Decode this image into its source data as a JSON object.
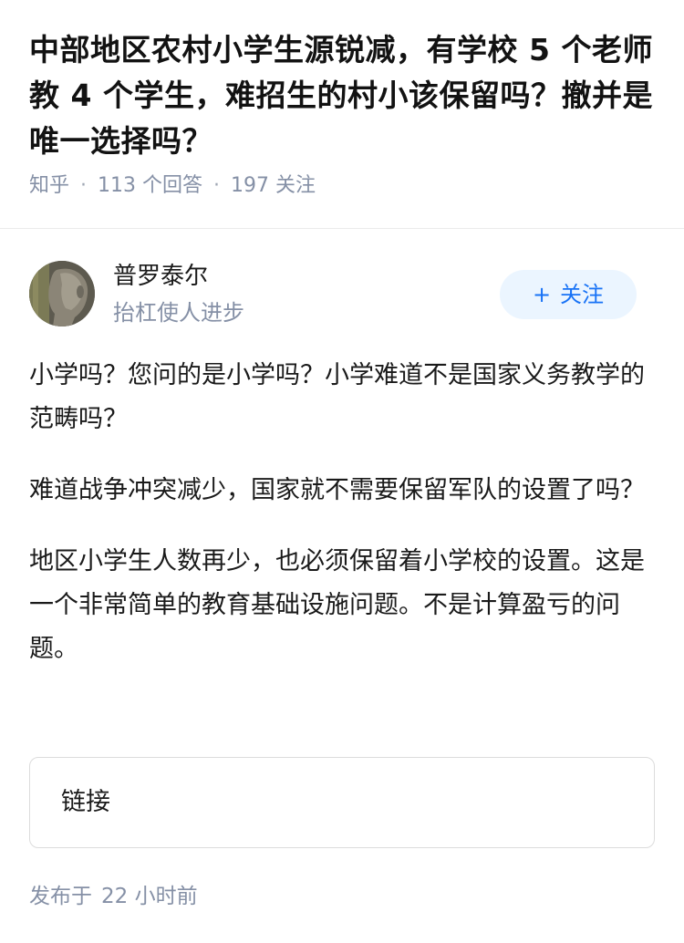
{
  "question": {
    "title": "中部地区农村小学生源锐减，有学校 5 个老师教 4 个学生，难招生的村小该保留吗？撤并是唯一选择吗？",
    "source": "知乎",
    "answers_count": "113 个回答",
    "followers_count": "197 关注"
  },
  "author": {
    "name": "普罗泰尔",
    "bio": "抬杠使人进步",
    "avatar_icon": "avatar-photo",
    "follow_label": "关注",
    "follow_plus": "+"
  },
  "answer": {
    "paragraphs": [
      "小学吗？您问的是小学吗？小学难道不是国家义务教学的范畴吗？",
      "难道战争冲突减少，国家就不需要保留军队的设置了吗？",
      "地区小学生人数再少，也必须保留着小学校的设置。这是一个非常简单的教育基础设施问题。不是计算盈亏的问题。"
    ]
  },
  "link_card": {
    "label": "链接"
  },
  "footer": {
    "published_prefix": "发布于",
    "published_time": "22 小时前"
  },
  "colors": {
    "meta_gray": "#8590a6",
    "accent_blue": "#1772f6",
    "follow_bg": "#ebf5ff"
  }
}
